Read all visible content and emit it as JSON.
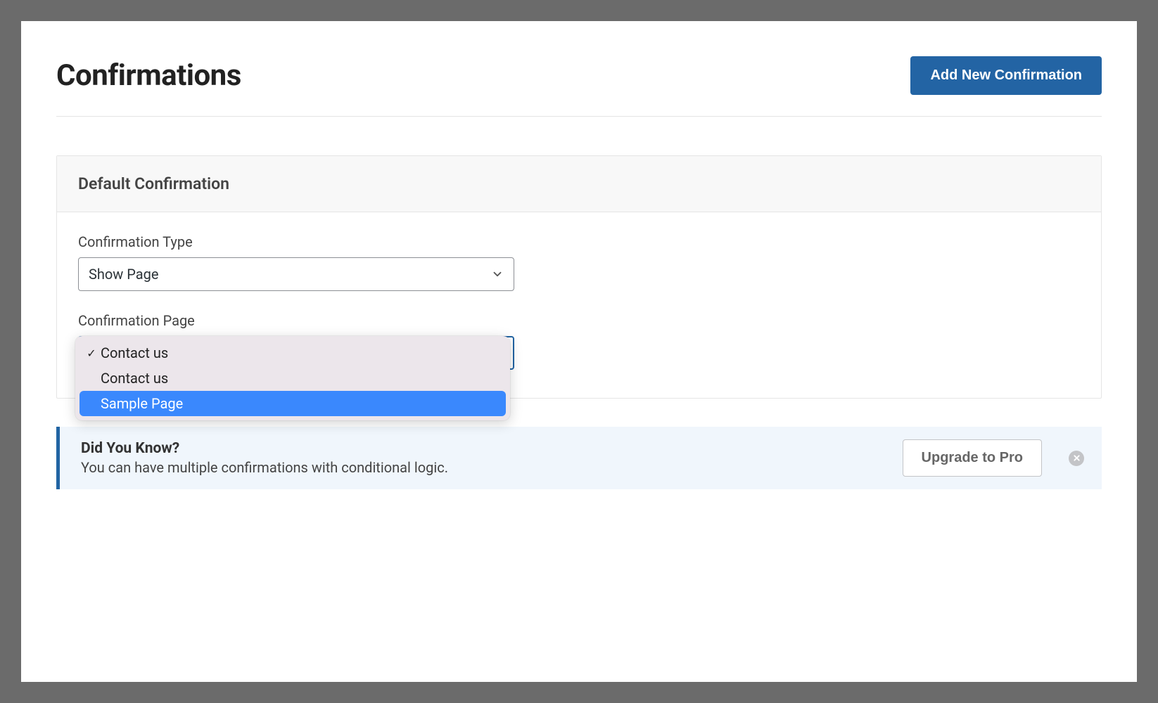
{
  "header": {
    "title": "Confirmations",
    "add_button": "Add New Confirmation"
  },
  "card": {
    "title": "Default Confirmation",
    "type_label": "Confirmation Type",
    "type_value": "Show Page",
    "page_label": "Confirmation Page",
    "page_options": [
      {
        "label": "Contact us",
        "selected": true,
        "hover": false
      },
      {
        "label": "Contact us",
        "selected": false,
        "hover": false
      },
      {
        "label": "Sample Page",
        "selected": false,
        "hover": true
      }
    ]
  },
  "banner": {
    "title": "Did You Know?",
    "desc": "You can have multiple confirmations with conditional logic.",
    "upgrade": "Upgrade to Pro"
  }
}
